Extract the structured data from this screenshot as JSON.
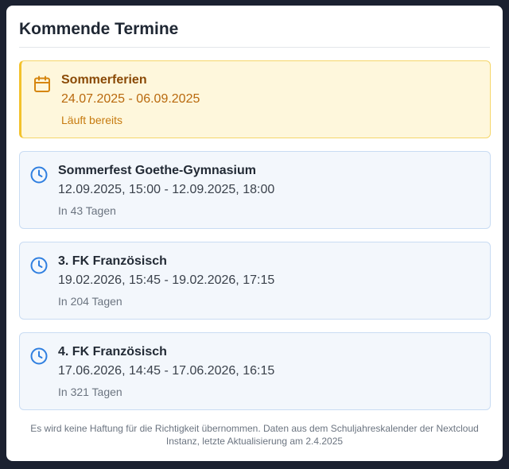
{
  "widget": {
    "title": "Kommende Termine",
    "footer": "Es wird keine Haftung für die Richtigkeit übernommen. Daten aus dem Schuljahreskalender der Nextcloud Instanz, letzte Aktualisierung am 2.4.2025"
  },
  "events": [
    {
      "title": "Sommerferien",
      "time": "24.07.2025 - 06.09.2025",
      "status": "Läuft bereits",
      "icon": "calendar-icon"
    },
    {
      "title": "Sommerfest Goethe-Gymnasium",
      "time": "12.09.2025, 15:00 - 12.09.2025, 18:00",
      "status": "In 43 Tagen",
      "icon": "clock-icon"
    },
    {
      "title": "3. FK Französisch",
      "time": "19.02.2026, 15:45 - 19.02.2026, 17:15",
      "status": "In 204 Tagen",
      "icon": "clock-icon"
    },
    {
      "title": "4. FK Französisch",
      "time": "17.06.2026, 14:45 - 17.06.2026, 16:15",
      "status": "In 321 Tagen",
      "icon": "clock-icon"
    }
  ],
  "colors": {
    "active_accent": "#f3c22c",
    "active_text": "#b9690d",
    "upcoming_icon": "#2f7fe0"
  }
}
